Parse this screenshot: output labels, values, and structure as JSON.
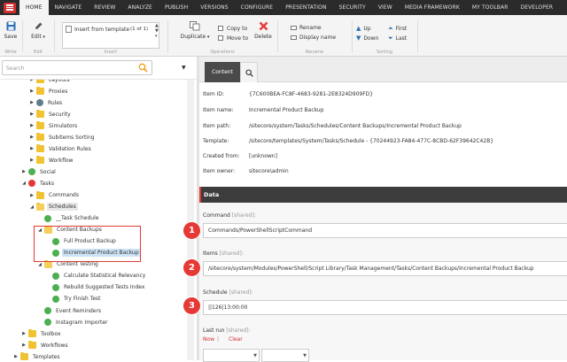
{
  "colors": {
    "accent": "#e53935",
    "topbar": "#2b2b2b",
    "selection": "#cbe3f5",
    "folder": "#f1c232"
  },
  "topmenu": [
    "HOME",
    "NAVIGATE",
    "REVIEW",
    "ANALYZE",
    "PUBLISH",
    "VERSIONS",
    "CONFIGURE",
    "PRESENTATION",
    "SECURITY",
    "VIEW",
    "MEDIA FRAMEWORK",
    "MY TOOLBAR",
    "DEVELOPER"
  ],
  "ribbon": {
    "save": "Save",
    "write": "Write",
    "edit": "Edit",
    "edit_group": "Edit",
    "insert_from_template": "Insert from template",
    "insert_count": "(1 of 1)",
    "insert_group": "Insert",
    "duplicate": "Duplicate",
    "copy_to": "Copy to",
    "move_to": "Move to",
    "delete": "Delete",
    "operations_group": "Operations",
    "rename": "Rename",
    "display_name": "Display name",
    "rename_group": "Rename",
    "up": "Up",
    "down": "Down",
    "first": "First",
    "last": "Last",
    "sorting_group": "Sorting"
  },
  "search": {
    "placeholder": "Search"
  },
  "tree": [
    {
      "label": "Layouts",
      "icon": "folder",
      "indent": 3,
      "arrow": "▶"
    },
    {
      "label": "Proxies",
      "icon": "folder",
      "indent": 3,
      "arrow": "▶"
    },
    {
      "label": "Rules",
      "icon": "rules",
      "indent": 3,
      "arrow": "▶"
    },
    {
      "label": "Security",
      "icon": "folder",
      "indent": 3,
      "arrow": "▶"
    },
    {
      "label": "Simulators",
      "icon": "folder",
      "indent": 3,
      "arrow": "▶"
    },
    {
      "label": "Subitems Sorting",
      "icon": "folder",
      "indent": 3,
      "arrow": "▶"
    },
    {
      "label": "Validation Rules",
      "icon": "folder",
      "indent": 3,
      "arrow": "▶"
    },
    {
      "label": "Workflow",
      "icon": "folder",
      "indent": 3,
      "arrow": "▶"
    },
    {
      "label": "Social",
      "icon": "gicon",
      "indent": 2,
      "arrow": "▶"
    },
    {
      "label": "Tasks",
      "icon": "gear",
      "indent": 2,
      "arrow": "◢"
    },
    {
      "label": "Commands",
      "icon": "folder",
      "indent": 3,
      "arrow": "▶"
    },
    {
      "label": "Schedules",
      "icon": "folder",
      "indent": 3,
      "arrow": "◢",
      "state": "dim"
    },
    {
      "label": "__Task Schedule",
      "icon": "gicon",
      "indent": 4,
      "arrow": ""
    },
    {
      "label": "Content Backups",
      "icon": "folder",
      "indent": 4,
      "arrow": "◢"
    },
    {
      "label": "Full Product Backup",
      "icon": "gicon",
      "indent": 5,
      "arrow": ""
    },
    {
      "label": "Incremental Product Backup",
      "icon": "gicon",
      "indent": 5,
      "arrow": "",
      "state": "sel"
    },
    {
      "label": "Content Testing",
      "icon": "folder",
      "indent": 4,
      "arrow": "◢"
    },
    {
      "label": "Calculate Statistical Relevancy",
      "icon": "gicon",
      "indent": 5,
      "arrow": ""
    },
    {
      "label": "Rebuild Suggested Tests Index",
      "icon": "gicon",
      "indent": 5,
      "arrow": ""
    },
    {
      "label": "Try Finish Test",
      "icon": "gicon",
      "indent": 5,
      "arrow": ""
    },
    {
      "label": "Event Reminders",
      "icon": "gicon",
      "indent": 4,
      "arrow": ""
    },
    {
      "label": "Instagram Importer",
      "icon": "gicon",
      "indent": 4,
      "arrow": ""
    },
    {
      "label": "Toolbox",
      "icon": "folder",
      "indent": 2,
      "arrow": "▶"
    },
    {
      "label": "Workflows",
      "icon": "folder",
      "indent": 2,
      "arrow": "▶"
    },
    {
      "label": "Templates",
      "icon": "folder",
      "indent": 1,
      "arrow": "▶"
    }
  ],
  "tabs": {
    "content": "Content"
  },
  "info": [
    {
      "key": "Item ID:",
      "value": "{7C600BEA-FC8F-4683-9281-2E8324D909FD}"
    },
    {
      "key": "Item name:",
      "value": "Incremental Product Backup"
    },
    {
      "key": "Item path:",
      "value": "/sitecore/system/Tasks/Schedules/Content Backups/Incremental Product Backup"
    },
    {
      "key": "Template:",
      "value": "/sitecore/templates/System/Tasks/Schedule - {70244923-FA84-477C-8CBD-62F39642C42B}"
    },
    {
      "key": "Created from:",
      "value": "[unknown]"
    },
    {
      "key": "Item owner:",
      "value": "sitecore\\admin"
    }
  ],
  "data_section": "Data",
  "fields": [
    {
      "label": "Command",
      "shared": "[shared]:",
      "value": "Commands/PowerShellScriptCommand",
      "badge": "1"
    },
    {
      "label": "Items",
      "shared": "[shared]:",
      "value": "/sitecore/system/Modules/PowerShell/Script Library/Task Management/Tasks/Content Backups/Incremental Product Backup",
      "badge": "2"
    },
    {
      "label": "Schedule",
      "shared": "[shared]:",
      "value": "||126|13:00:00",
      "badge": "3"
    }
  ],
  "last_run": {
    "label": "Last run",
    "shared": "[shared]:",
    "now": "Now",
    "clear": "Clear"
  }
}
